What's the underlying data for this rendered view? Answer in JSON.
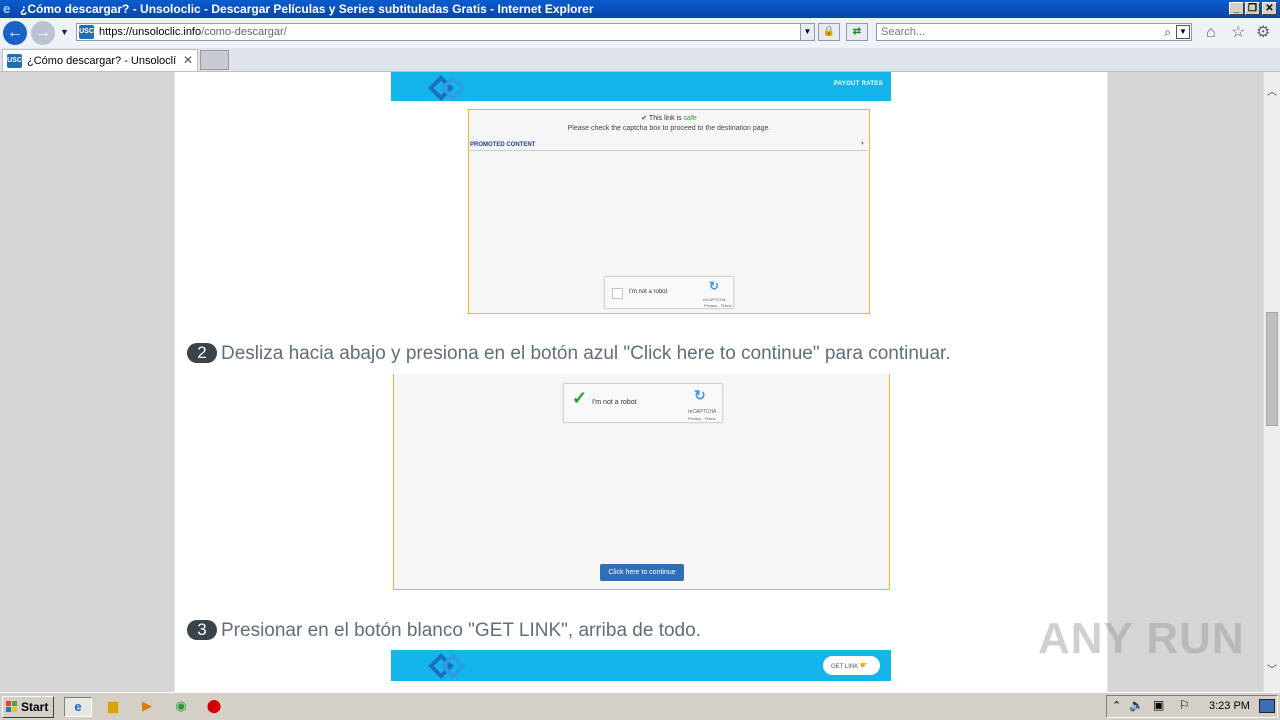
{
  "window": {
    "title": "¿Cómo descargar? - Unsoloclic - Descargar Películas y Series subtituladas Gratis - Internet Explorer",
    "controls": [
      "_",
      "❐",
      "✕"
    ]
  },
  "navbar": {
    "url_host": "https://unsoloclic.info",
    "url_path": "/como-descargar/",
    "favicon_text": "USC",
    "search_placeholder": "Search..."
  },
  "tabs": [
    {
      "label": "¿Cómo descargar? - Unsoloclí...",
      "favicon_text": "USC",
      "close": "✕"
    }
  ],
  "page": {
    "banner_top": {
      "right_link": "PAYOUT RATES"
    },
    "box1": {
      "safe_prefix": "This link is ",
      "safe_word": "safe",
      "instruction": "Please check the captcha box to proceed to the destination page.",
      "promoted": "PROMOTED CONTENT",
      "recaptcha_label": "I'm not a robot",
      "recaptcha_brand": "reCAPTCHA",
      "recaptcha_links": "Privacy - Terms"
    },
    "step2": {
      "num": "2",
      "text": "Desliza hacia abajo y presiona en el botón azul \"Click here to continue\" para continuar."
    },
    "box2": {
      "recaptcha_label": "I'm not a robot",
      "recaptcha_brand": "reCAPTCHA",
      "recaptcha_links": "Privacy - Terms",
      "continue_button": "Click here to continue"
    },
    "step3": {
      "num": "3",
      "text": "Presionar en el botón blanco \"GET LINK\", arriba de todo."
    },
    "banner_bottom": {
      "button": "GET LINK"
    }
  },
  "taskbar": {
    "start": "Start",
    "clock": "3:23 PM"
  },
  "watermark": "ANY RUN",
  "colors": {
    "banner": "#13b5ea",
    "continue_button": "#2f6fb5",
    "step_badge": "#3b4249",
    "box_border": "#f0b429"
  }
}
